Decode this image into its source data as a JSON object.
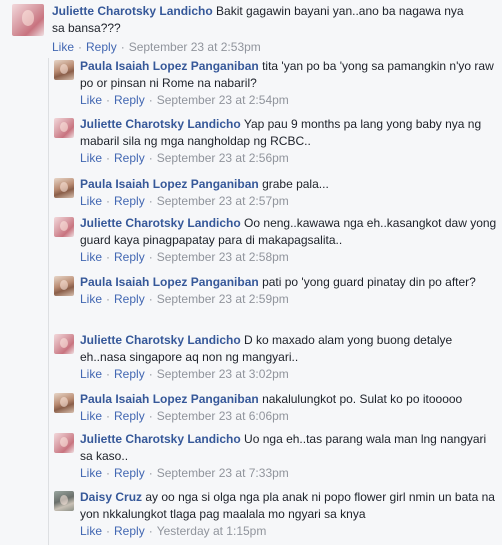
{
  "top_comment": {
    "author": "Juliette Charotsky Landicho",
    "text": "Bakit gagawin bayani yan..ano ba nagawa nya sa bansa???",
    "like_label": "Like",
    "reply_label": "Reply",
    "date": "September 23 at 2:53pm"
  },
  "replies": [
    {
      "author": "Paula Isaiah Lopez Panganiban",
      "text": "tita 'yan po ba 'yong sa pamangkin n'yo raw po or pinsan ni Rome na nabaril?",
      "like_label": "Like",
      "reply_label": "Reply",
      "date": "September 23 at 2:54pm",
      "avatar": "paula"
    },
    {
      "author": "Juliette Charotsky Landicho",
      "text": "Yap pau 9 months pa lang yong baby nya ng mabaril sila ng mga nangholdap ng RCBC..",
      "like_label": "Like",
      "reply_label": "Reply",
      "date": "September 23 at 2:56pm",
      "avatar": "juliette"
    },
    {
      "author": "Paula Isaiah Lopez Panganiban",
      "text": "grabe pala...",
      "like_label": "Like",
      "reply_label": "Reply",
      "date": "September 23 at 2:57pm",
      "avatar": "paula"
    },
    {
      "author": "Juliette Charotsky Landicho",
      "text": "Oo neng..kawawa nga eh..kasangkot daw yong guard kaya pinagpapatay para di makapagsalita..",
      "like_label": "Like",
      "reply_label": "Reply",
      "date": "September 23 at 2:58pm",
      "avatar": "juliette"
    },
    {
      "author": "Paula Isaiah Lopez Panganiban",
      "text": "pati po 'yong guard pinatay din po after?",
      "like_label": "Like",
      "reply_label": "Reply",
      "date": "September 23 at 2:59pm",
      "avatar": "paula"
    },
    {
      "author": "Juliette Charotsky Landicho",
      "text": "D ko maxado alam yong buong detalye eh..nasa singapore aq non ng mangyari..",
      "like_label": "Like",
      "reply_label": "Reply",
      "date": "September 23 at 3:02pm",
      "avatar": "juliette"
    },
    {
      "author": "Paula Isaiah Lopez Panganiban",
      "text": "nakalulungkot po. Sulat ko po itooooo",
      "like_label": "Like",
      "reply_label": "Reply",
      "date": "September 23 at 6:06pm",
      "avatar": "paula"
    },
    {
      "author": "Juliette Charotsky Landicho",
      "text": "Uo nga eh..tas parang wala man lng nangyari sa kaso..",
      "like_label": "Like",
      "reply_label": "Reply",
      "date": "September 23 at 7:33pm",
      "avatar": "juliette"
    },
    {
      "author": "Daisy Cruz",
      "text": "ay oo nga si olga nga pla anak ni popo flower girl nmin un bata na yon nkkalungkot tlaga pag maalala mo ngyari sa knya",
      "like_label": "Like",
      "reply_label": "Reply",
      "date": "Yesterday at 1:15pm",
      "avatar": "daisy"
    }
  ]
}
